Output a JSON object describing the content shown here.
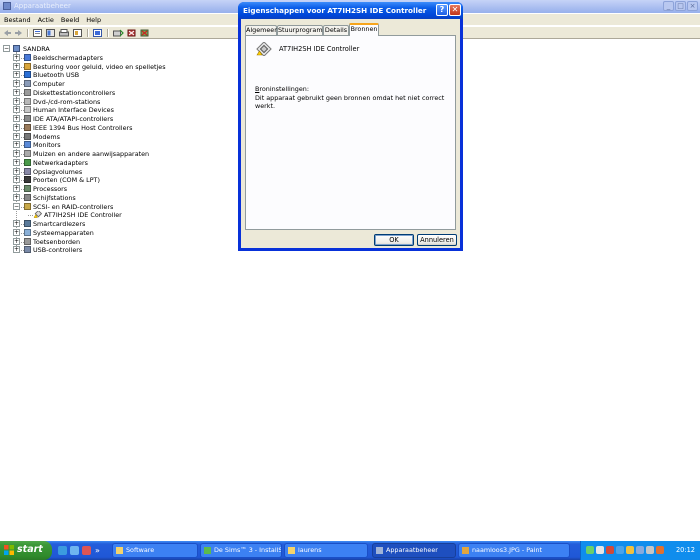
{
  "main": {
    "title": "Apparaatbeheer",
    "menu": [
      "Bestand",
      "Actie",
      "Beeld",
      "Help"
    ],
    "toolbar": [
      "back-icon",
      "forward-icon",
      "properties-icon",
      "console-icon",
      "print-icon",
      "help-icon",
      "refresh-icon",
      "scan-icon",
      "disable-icon",
      "uninstall-icon"
    ],
    "tree": {
      "root": "SANDRA",
      "items": [
        "Beeldschermadapters",
        "Besturing voor geluid, video en spelletjes",
        "Bluetooth USB",
        "Computer",
        "Diskettestationcontrollers",
        "Dvd-/cd-rom-stations",
        "Human Interface Devices",
        "IDE ATA/ATAPI-controllers",
        "IEEE 1394 Bus Host Controllers",
        "Modems",
        "Monitors",
        "Muizen en andere aanwijsapparaten",
        "Netwerkadapters",
        "Opslagvolumes",
        "Poorten (COM & LPT)",
        "Processors",
        "Schijfstations",
        "SCSI- en RAID-controllers",
        "Smartcardlezers",
        "Systeemapparaten",
        "Toetsenborden",
        "USB-controllers"
      ],
      "child": "AT7IH2SH IDE Controller"
    }
  },
  "dialog": {
    "title": "Eigenschappen voor AT7IH2SH IDE Controller",
    "help": "?",
    "close": "✕",
    "tabs": [
      "Algemeen",
      "Stuurprogramma",
      "Details",
      "Bronnen"
    ],
    "device_name": "AT7IH2SH IDE Controller",
    "resources_label": "Broninstellingen:",
    "resources_message": "Dit apparaat gebruikt geen bronnen omdat het niet correct werkt.",
    "ok": "OK",
    "cancel": "Annuleren"
  },
  "taskbar": {
    "start": "start",
    "tasks": [
      "Software",
      "De Sims™ 3 - InstallS...",
      "laurens",
      "Apparaatbeheer",
      "naamloos3.JPG - Paint"
    ],
    "clock": "20:12"
  },
  "colors": {
    "xp_blue": "#0a5ce8",
    "taskbar": "#245edb",
    "start_green": "#3c9838",
    "dialog_face": "#ece9d8"
  }
}
